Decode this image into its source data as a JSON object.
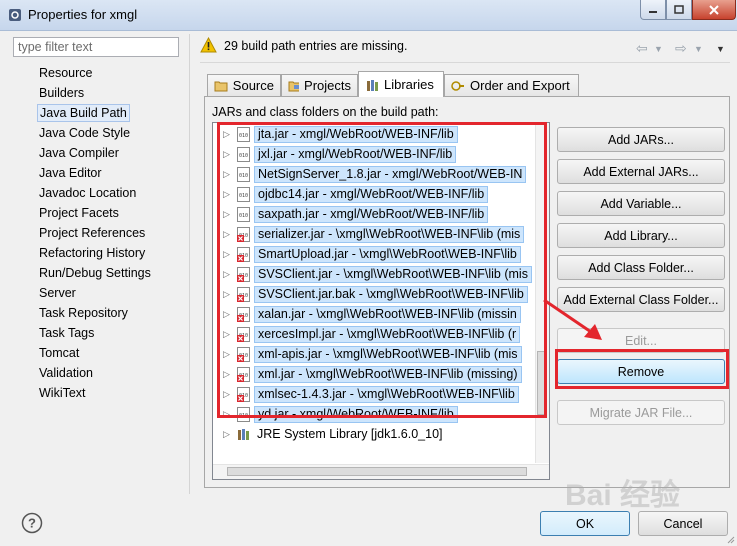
{
  "window": {
    "title": "Properties for xmgl"
  },
  "filter": {
    "placeholder": "type filter text"
  },
  "nav": {
    "items": [
      "Resource",
      "Builders",
      "Java Build Path",
      "Java Code Style",
      "Java Compiler",
      "Java Editor",
      "Javadoc Location",
      "Project Facets",
      "Project References",
      "Refactoring History",
      "Run/Debug Settings",
      "Server",
      "Task Repository",
      "Task Tags",
      "Tomcat",
      "Validation",
      "WikiText"
    ],
    "selected": "Java Build Path"
  },
  "header": {
    "message": "29 build path entries are missing."
  },
  "tabs": [
    {
      "label": "Source",
      "icon": "source-folder-icon"
    },
    {
      "label": "Projects",
      "icon": "projects-icon"
    },
    {
      "label": "Libraries",
      "icon": "libraries-icon"
    },
    {
      "label": "Order and Export",
      "icon": "order-export-icon"
    }
  ],
  "active_tab": "Libraries",
  "jars_label": "JARs and class folders on the build path:",
  "entries": [
    {
      "label": "jta.jar - xmgl/WebRoot/WEB-INF/lib",
      "missing": false,
      "selected": true
    },
    {
      "label": "jxl.jar - xmgl/WebRoot/WEB-INF/lib",
      "missing": false,
      "selected": true
    },
    {
      "label": "NetSignServer_1.8.jar - xmgl/WebRoot/WEB-IN",
      "missing": false,
      "selected": true
    },
    {
      "label": "ojdbc14.jar - xmgl/WebRoot/WEB-INF/lib",
      "missing": false,
      "selected": true
    },
    {
      "label": "saxpath.jar - xmgl/WebRoot/WEB-INF/lib",
      "missing": false,
      "selected": true
    },
    {
      "label": "serializer.jar - \\xmgl\\WebRoot\\WEB-INF\\lib (mis",
      "missing": true,
      "selected": true
    },
    {
      "label": "SmartUpload.jar - \\xmgl\\WebRoot\\WEB-INF\\lib",
      "missing": true,
      "selected": true
    },
    {
      "label": "SVSClient.jar - \\xmgl\\WebRoot\\WEB-INF\\lib (mis",
      "missing": true,
      "selected": true
    },
    {
      "label": "SVSClient.jar.bak - \\xmgl\\WebRoot\\WEB-INF\\lib",
      "missing": true,
      "selected": true
    },
    {
      "label": "xalan.jar - \\xmgl\\WebRoot\\WEB-INF\\lib (missin",
      "missing": true,
      "selected": true
    },
    {
      "label": "xercesImpl.jar - \\xmgl\\WebRoot\\WEB-INF\\lib (r",
      "missing": true,
      "selected": true
    },
    {
      "label": "xml-apis.jar - \\xmgl\\WebRoot\\WEB-INF\\lib (mis",
      "missing": true,
      "selected": true
    },
    {
      "label": "xml.jar - \\xmgl\\WebRoot\\WEB-INF\\lib (missing)",
      "missing": true,
      "selected": true
    },
    {
      "label": "xmlsec-1.4.3.jar - \\xmgl\\WebRoot\\WEB-INF\\lib",
      "missing": true,
      "selected": true
    },
    {
      "label": "yd.jar - xmgl/WebRoot/WEB-INF/lib",
      "missing": false,
      "selected": true
    },
    {
      "label": "JRE System Library [jdk1.6.0_10]",
      "missing": false,
      "selected": false
    }
  ],
  "buttons": {
    "add_jars": "Add JARs...",
    "add_external_jars": "Add External JARs...",
    "add_variable": "Add Variable...",
    "add_library": "Add Library...",
    "add_class_folder": "Add Class Folder...",
    "add_external_class_folder": "Add External Class Folder...",
    "edit": "Edit...",
    "remove": "Remove",
    "migrate_jar": "Migrate JAR File..."
  },
  "footer": {
    "ok": "OK",
    "cancel": "Cancel"
  },
  "watermark": "Bai 经验",
  "colors": {
    "highlight": "#e3262d",
    "selection": "#cde5fc",
    "warning": "#f2c200"
  }
}
